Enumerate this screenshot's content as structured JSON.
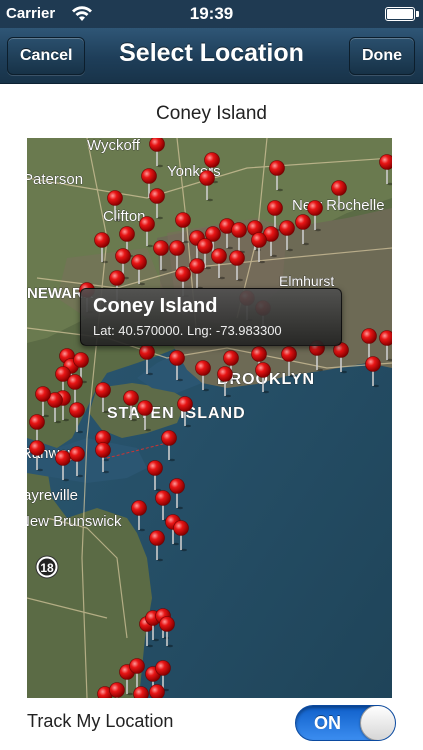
{
  "status_bar": {
    "carrier": "Carrier",
    "time": "19:39",
    "battery_level": 1.0
  },
  "nav": {
    "title": "Select Location",
    "cancel_label": "Cancel",
    "done_label": "Done"
  },
  "location": {
    "name": "Coney Island"
  },
  "map": {
    "labels": [
      "Wyckoff",
      "Yonkers",
      "Paterson",
      "Clifton",
      "New Rochelle",
      "NEWARK",
      "Elmhurst",
      "BROOKLYN",
      "STATEN ISLAND",
      "Rahway",
      "Sayreville",
      "New Brunswick",
      "18"
    ],
    "callout": {
      "title": "Coney Island",
      "subtitle": "Lat: 40.570000. Lng: -73.983300"
    }
  },
  "track": {
    "label": "Track My Location",
    "toggle_label": "ON",
    "enabled": true
  }
}
